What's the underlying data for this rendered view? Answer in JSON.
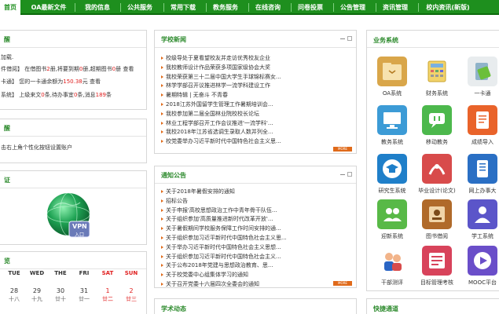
{
  "nav": [
    {
      "label": "首页",
      "active": true
    },
    {
      "label": "OA最新文件"
    },
    {
      "label": "我的信息"
    },
    {
      "label": "公共服务"
    },
    {
      "label": "常用下载"
    },
    {
      "label": "教务服务"
    },
    {
      "label": "在线咨询"
    },
    {
      "label": "问卷投票"
    },
    {
      "label": "公告管理"
    },
    {
      "label": "资讯管理"
    },
    {
      "label": "校内资讯(新版)"
    }
  ],
  "left": {
    "p1_title": "醒",
    "p1_line1": "加载.",
    "p1_l2_a": "件借阅】 在借图书",
    "p1_l2_b": "2",
    "p1_l2_c": "册,将要到期",
    "p1_l2_d": "0",
    "p1_l2_e": "册,超期图书",
    "p1_l2_f": "0",
    "p1_l2_g": "册 查看",
    "p1_l3_a": "卡通】 您的一卡通余额为",
    "p1_l3_b": "150.38",
    "p1_l3_c": "元 查看",
    "p1_l4_a": "系统】 上级来文",
    "p1_l4_b": "0",
    "p1_l4_c": "条,待办事宜",
    "p1_l4_d": "0",
    "p1_l4_e": "条,消息",
    "p1_l4_f": "189",
    "p1_l4_g": "条",
    "p2_title": "醒",
    "p2_line": "击右上角个性化按钮设置账户",
    "p3_title": "证",
    "vpn_text": "VPN",
    "vpn_sub": "入口",
    "p4_title": "览"
  },
  "calendar": {
    "headers": [
      "TUE",
      "WED",
      "THE",
      "FRI",
      "SAT",
      "SUN"
    ],
    "days": [
      {
        "d": "28",
        "l": "十八"
      },
      {
        "d": "29",
        "l": "十九"
      },
      {
        "d": "30",
        "l": "廿十"
      },
      {
        "d": "31",
        "l": "廿一"
      },
      {
        "d": "1",
        "l": "廿二"
      },
      {
        "d": "2",
        "l": "廿三"
      }
    ]
  },
  "news": {
    "title": "学校新闻",
    "items": [
      "校级导处于夏看望校友并走访优秀校友企业",
      "我校教师设计作品荣获多项国家级协会大奖",
      "我校荣获第三十二届中国大学生手球锦标赛女...",
      "林学学部召开议推进林学一流学科建设工作",
      "暑期特辑 | 无奋斗 不青春",
      "2018江苏外国留学生管理工作暑期培训会...",
      "我校参加第二届全国林业院校校长论坛",
      "林业工程学部召开工作会议推进'一流学科'...",
      "我校2018年江苏省选调生录取人数并列全...",
      "校党委举办习近平新时代中国特色社会主义思..."
    ],
    "more": "MORE"
  },
  "notice": {
    "title": "通知公告",
    "items": [
      "关于2018年暑假安排的通知",
      "招标公告",
      "关于申报'高校思想政治工作中青年骨干队伍...",
      "关于组织参加'高质量推进新时代改革开放'...",
      "关于暑假期间学校服务保障工作时间安排的通...",
      "关于组织参加习近平新时代中国特色社会主义思...",
      "关于举办习近平新时代中国特色社会主义思想...",
      "关于组织参加习近平新时代中国特色社会主义...",
      "关于公布2018年党建与思想政治教育、思...",
      "关于校党委中心组集体学习的通知",
      "关于召开党委十六届四次全委会的通知"
    ],
    "more": "MORE"
  },
  "academic_title": "学术动态",
  "business": {
    "title": "业务系统",
    "apps": [
      {
        "label": "OA系统",
        "icon": "oa-folder-icon"
      },
      {
        "label": "财务系统",
        "icon": "finance-calculator-icon"
      },
      {
        "label": "一卡通",
        "icon": "card-reader-icon"
      },
      {
        "label": "教务系统",
        "icon": "academic-monitor-icon"
      },
      {
        "label": "移动教务",
        "icon": "mobile-chat-icon"
      },
      {
        "label": "成绩导入",
        "icon": "grade-import-icon"
      },
      {
        "label": "研究生系统",
        "icon": "graduate-cap-icon"
      },
      {
        "label": "毕业设计(论文)",
        "icon": "thesis-design-icon"
      },
      {
        "label": "网上办事大",
        "icon": "online-service-icon"
      },
      {
        "label": "迎新系统",
        "icon": "welcome-users-icon"
      },
      {
        "label": "图书借阅",
        "icon": "library-book-icon"
      },
      {
        "label": "学工系统",
        "icon": "student-affairs-icon"
      },
      {
        "label": "干部测评",
        "icon": "cadre-assessment-icon"
      },
      {
        "label": "目标管理考核",
        "icon": "target-management-icon"
      },
      {
        "label": "MOOC平台",
        "icon": "mooc-platform-icon"
      }
    ]
  },
  "quick_title": "快捷通道"
}
